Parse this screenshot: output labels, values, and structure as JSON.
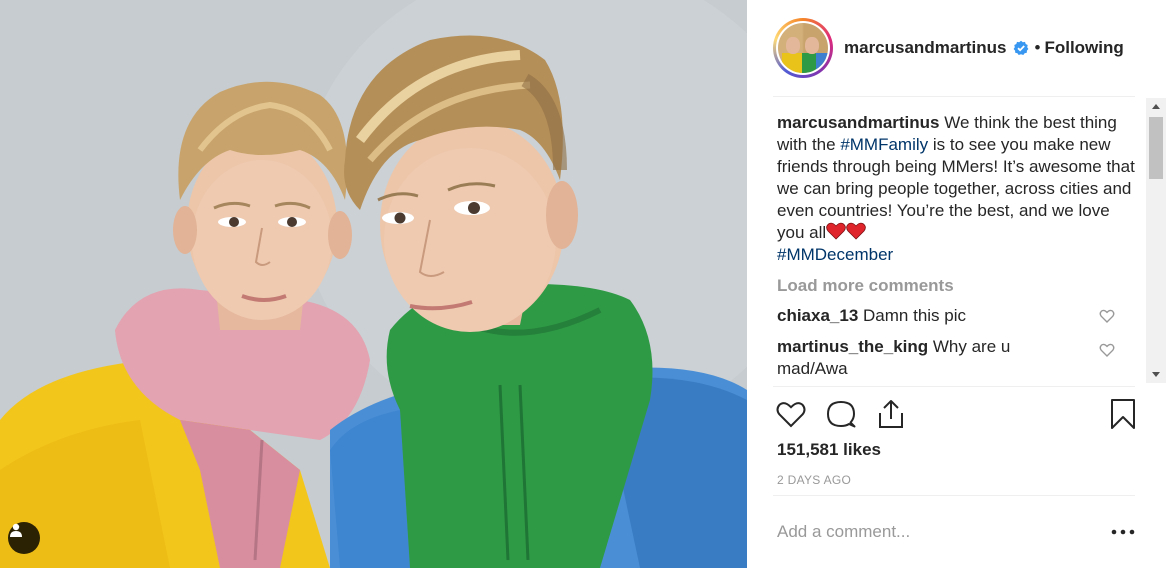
{
  "post": {
    "username": "marcusandmartinus",
    "separator": "•",
    "follow_status": "Following"
  },
  "caption": {
    "username": "marcusandmartinus",
    "text_1": " We think the best thing with the ",
    "hashtag_1": "#MMFamily",
    "text_2": " is to see you make new friends through being MMers! It’s awesome that we can bring people together, across cities and even countries! You’re the best, and we love you all",
    "hashtag_2": "#MMDecember"
  },
  "load_more_label": "Load more comments",
  "comments": [
    {
      "username": "chiaxa_13",
      "text": " Damn this pic"
    },
    {
      "username": "martinus_the_king",
      "text": " Why are u mad/Awa"
    }
  ],
  "likes_text": "151,581 likes",
  "date_text": "2 DAYS AGO",
  "add_comment_placeholder": "Add a comment...",
  "more_label": "•••",
  "colors": {
    "verified_blue": "#3897f0",
    "hashtag_blue": "#003569",
    "heart_red": "#e0242b",
    "muted_gray": "#999999"
  },
  "icons": [
    "verified-icon",
    "heart-icon",
    "comment-icon",
    "share-icon",
    "bookmark-icon",
    "more-icon",
    "tag-people-icon",
    "heart-emoji"
  ]
}
